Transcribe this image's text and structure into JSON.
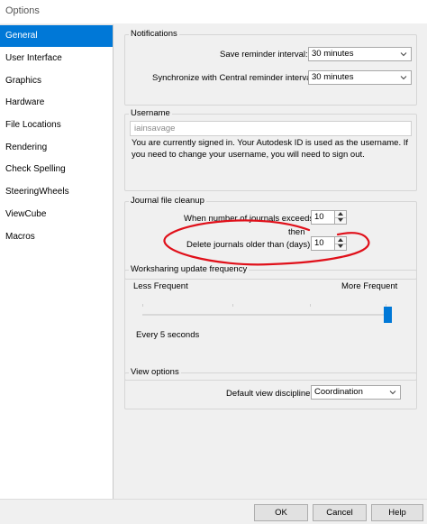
{
  "window": {
    "title": "Options"
  },
  "sidebar": {
    "items": [
      {
        "label": "General"
      },
      {
        "label": "User Interface"
      },
      {
        "label": "Graphics"
      },
      {
        "label": "Hardware"
      },
      {
        "label": "File Locations"
      },
      {
        "label": "Rendering"
      },
      {
        "label": "Check Spelling"
      },
      {
        "label": "SteeringWheels"
      },
      {
        "label": "ViewCube"
      },
      {
        "label": "Macros"
      }
    ],
    "active": "General"
  },
  "notifications": {
    "title": "Notifications",
    "save_label": "Save reminder interval:",
    "save_value": "30 minutes",
    "sync_label": "Synchronize with Central reminder interval:",
    "sync_value": "30 minutes"
  },
  "username": {
    "title": "Username",
    "value": "iainsavage",
    "message": "You are currently signed in. Your Autodesk ID is used as the username. If you need to change your username, you will need to sign out."
  },
  "journal": {
    "title": "Journal file cleanup",
    "exceeds_label": "When number of journals exceeds:",
    "exceeds_value": "10",
    "then_label": "then",
    "delete_label": "Delete journals older than (days):",
    "delete_value": "10"
  },
  "worksharing": {
    "title": "Worksharing update frequency",
    "less_label": "Less Frequent",
    "more_label": "More Frequent",
    "value_label": "Every 5 seconds",
    "slider_level": 1.0
  },
  "view_options": {
    "title": "View options",
    "discipline_label": "Default view discipline:",
    "discipline_value": "Coordination"
  },
  "footer": {
    "ok_label": "OK",
    "cancel_label": "Cancel",
    "help_label": "Help"
  },
  "colors": {
    "accent": "#0078d7",
    "annotation": "#e0101a"
  },
  "icons": {
    "dropdown": "chevron-down-icon",
    "spin_up": "triangle-up-icon",
    "spin_down": "triangle-down-icon"
  }
}
